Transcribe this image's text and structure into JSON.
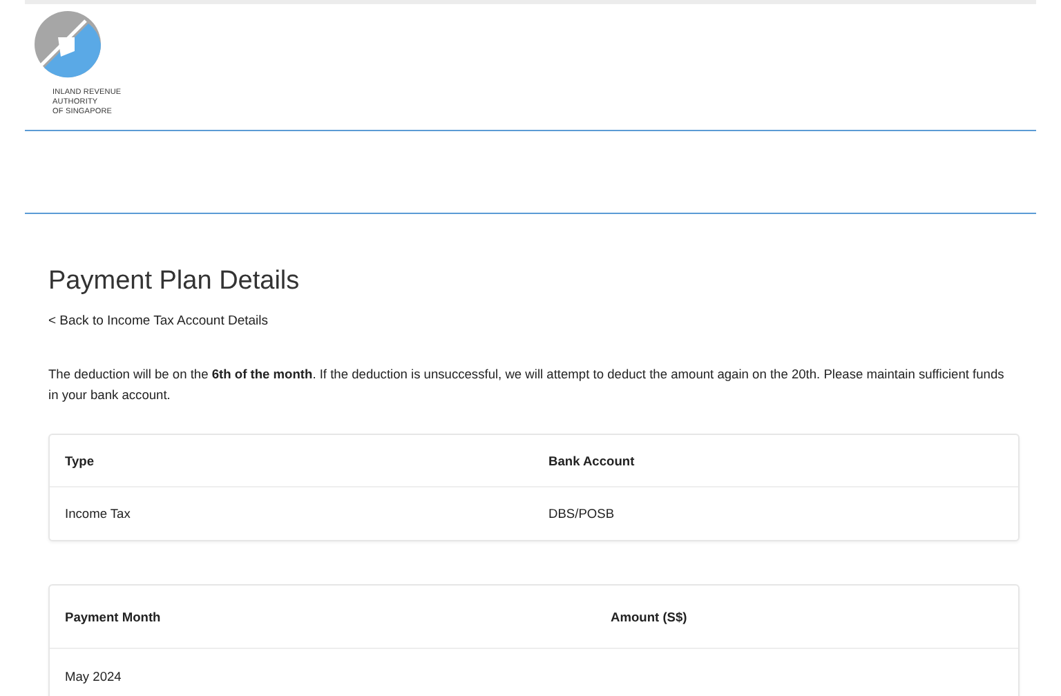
{
  "logo": {
    "lines": [
      "INLAND REVENUE",
      "AUTHORITY",
      "OF SINGAPORE"
    ]
  },
  "title": "Payment Plan Details",
  "back_link": "< Back to Income Tax Account Details",
  "notice": "The deduction will be on the **6th of the month**. If the deduction is unsuccessful, we will attempt to deduct the amount again on the 20th. Please maintain sufficient funds in your bank account.",
  "plan_table": {
    "columns": [
      "Type",
      "Bank Account"
    ],
    "rows": [
      [
        "Income Tax",
        "DBS/POSB"
      ]
    ]
  },
  "schedule_table": {
    "columns": [
      "Payment Month",
      "Amount (S$)"
    ],
    "rows": [
      [
        "May 2024"
      ]
    ]
  }
}
